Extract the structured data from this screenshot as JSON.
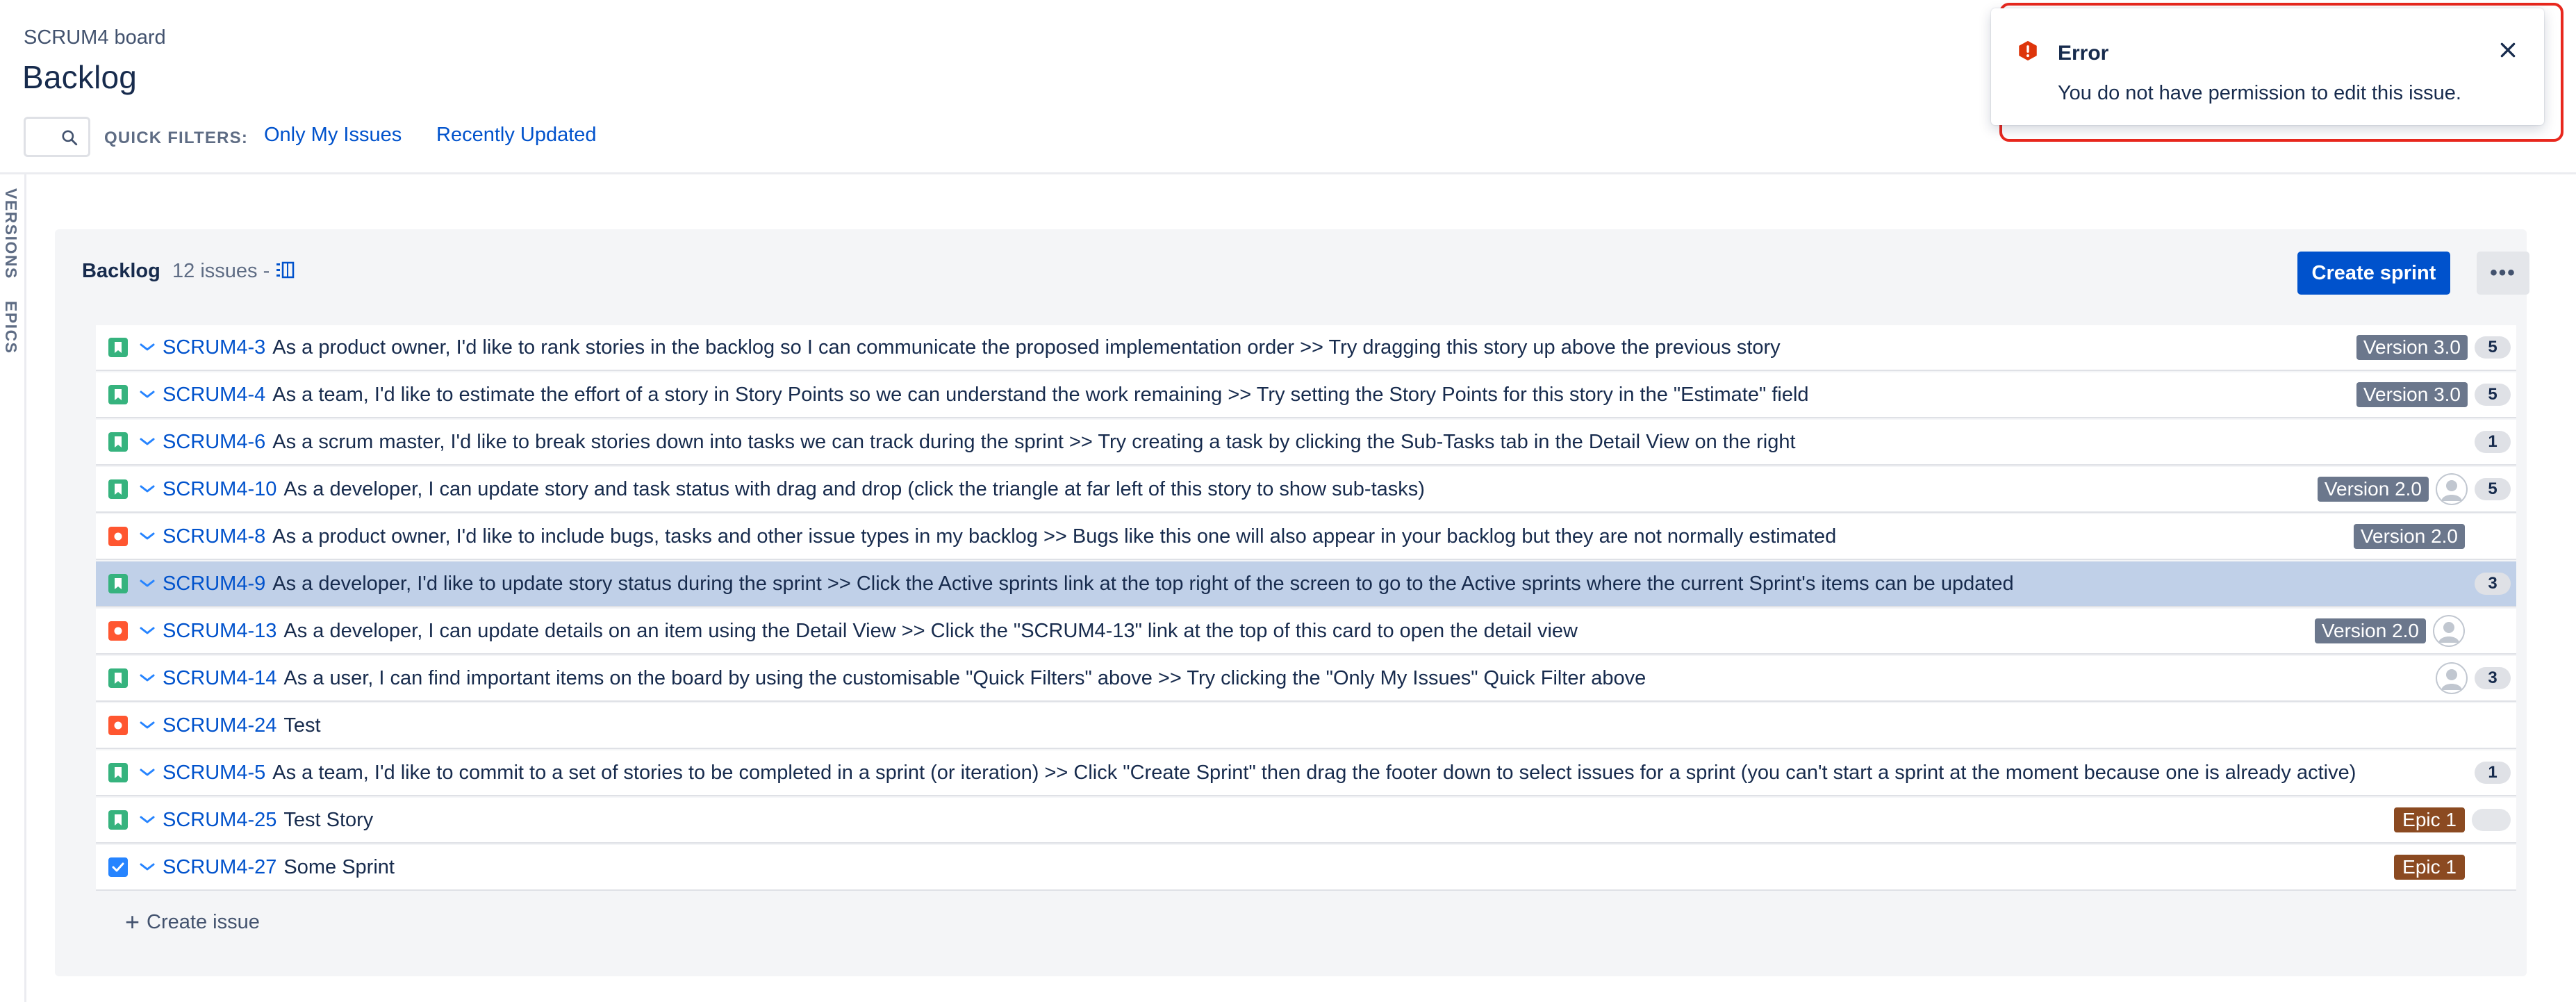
{
  "header": {
    "board_name": "SCRUM4 board",
    "title": "Backlog",
    "quick_filters_label": "QUICK FILTERS:",
    "quick_filters": [
      "Only My Issues",
      "Recently Updated"
    ]
  },
  "left_rail": {
    "versions_label": "VERSIONS",
    "epics_label": "EPICS"
  },
  "backlog": {
    "title": "Backlog",
    "count_text": "12 issues -",
    "create_sprint_label": "Create sprint",
    "more_label": "•••",
    "create_issue_label": "Create issue"
  },
  "issues": [
    {
      "type": "story",
      "key": "SCRUM4-3",
      "summary": "As a product owner, I'd like to rank stories in the backlog so I can communicate the proposed implementation order >> Try dragging this story up above the previous story",
      "version": "Version 3.0",
      "epic": "",
      "avatar": false,
      "points": "5",
      "selected": false
    },
    {
      "type": "story",
      "key": "SCRUM4-4",
      "summary": "As a team, I'd like to estimate the effort of a story in Story Points so we can understand the work remaining >> Try setting the Story Points for this story in the \"Estimate\" field",
      "version": "Version 3.0",
      "epic": "",
      "avatar": false,
      "points": "5",
      "selected": false
    },
    {
      "type": "story",
      "key": "SCRUM4-6",
      "summary": "As a scrum master, I'd like to break stories down into tasks we can track during the sprint >> Try creating a task by clicking the Sub-Tasks tab in the Detail View on the right",
      "version": "",
      "epic": "",
      "avatar": false,
      "points": "1",
      "selected": false
    },
    {
      "type": "story",
      "key": "SCRUM4-10",
      "summary": "As a developer, I can update story and task status with drag and drop (click the triangle at far left of this story to show sub-tasks)",
      "version": "Version 2.0",
      "epic": "",
      "avatar": true,
      "points": "5",
      "selected": false
    },
    {
      "type": "bug",
      "key": "SCRUM4-8",
      "summary": "As a product owner, I'd like to include bugs, tasks and other issue types in my backlog >> Bugs like this one will also appear in your backlog but they are not normally estimated",
      "version": "Version 2.0",
      "epic": "",
      "avatar": false,
      "points": "",
      "selected": false
    },
    {
      "type": "story",
      "key": "SCRUM4-9",
      "summary": "As a developer, I'd like to update story status during the sprint >> Click the Active sprints link at the top right of the screen to go to the Active sprints where the current Sprint's items can be updated",
      "version": "",
      "epic": "",
      "avatar": false,
      "points": "3",
      "selected": true
    },
    {
      "type": "bug",
      "key": "SCRUM4-13",
      "summary": "As a developer, I can update details on an item using the Detail View >> Click the \"SCRUM4-13\" link at the top of this card to open the detail view",
      "version": "Version 2.0",
      "epic": "",
      "avatar": true,
      "points": "",
      "selected": false
    },
    {
      "type": "story",
      "key": "SCRUM4-14",
      "summary": "As a user, I can find important items on the board by using the customisable \"Quick Filters\" above >> Try clicking the \"Only My Issues\" Quick Filter above",
      "version": "",
      "epic": "",
      "avatar": true,
      "points": "3",
      "selected": false
    },
    {
      "type": "bug",
      "key": "SCRUM4-24",
      "summary": "Test",
      "version": "",
      "epic": "",
      "avatar": false,
      "points": "",
      "selected": false
    },
    {
      "type": "story",
      "key": "SCRUM4-5",
      "summary": "As a team, I'd like to commit to a set of stories to be completed in a sprint (or iteration) >> Click \"Create Sprint\" then drag the footer down to select issues for a sprint (you can't start a sprint at the moment because one is already active)",
      "version": "",
      "epic": "",
      "avatar": false,
      "points": "1",
      "selected": false
    },
    {
      "type": "story",
      "key": "SCRUM4-25",
      "summary": "Test Story",
      "version": "",
      "epic": "Epic 1",
      "avatar": false,
      "points": "empty",
      "selected": false
    },
    {
      "type": "task",
      "key": "SCRUM4-27",
      "summary": "Some Sprint",
      "version": "",
      "epic": "Epic 1",
      "avatar": false,
      "points": "",
      "selected": false
    }
  ],
  "toast": {
    "title": "Error",
    "message": "You do not have permission to edit this issue."
  },
  "colors": {
    "accent": "#0052cc",
    "story": "#36b37e",
    "bug": "#ff5630",
    "task": "#2684ff",
    "version_badge": "#6b778c",
    "epic_badge": "#8b4a21",
    "error_outline": "#e8281e"
  },
  "icons": {
    "search": "search-icon",
    "story": "bookmark-icon",
    "bug": "bug-dot-icon",
    "task": "checkmark-icon",
    "priority": "chevron-down-icon",
    "error": "error-icon",
    "close": "close-icon"
  }
}
